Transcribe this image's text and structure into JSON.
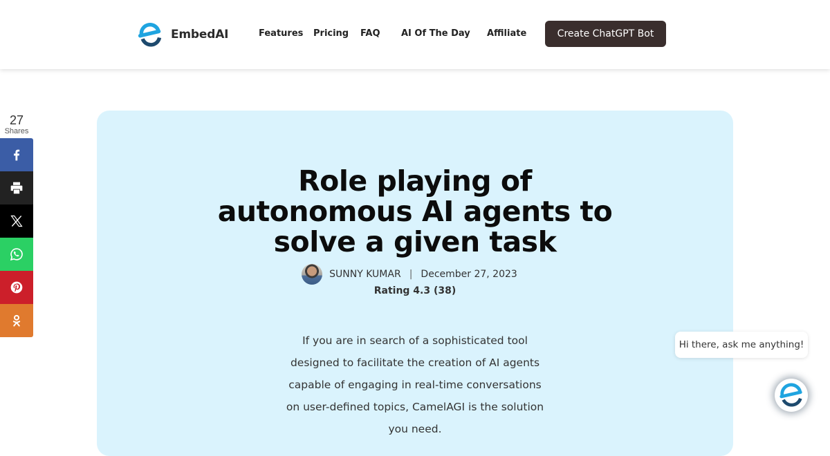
{
  "header": {
    "brand": "EmbedAI",
    "nav": [
      {
        "label": "Features"
      },
      {
        "label": "Pricing"
      },
      {
        "label": "FAQ"
      },
      {
        "label": "AI Of The Day"
      },
      {
        "label": "Affiliate"
      }
    ],
    "cta_label": "Create ChatGPT Bot"
  },
  "share": {
    "count": "27",
    "count_label": "Shares",
    "buttons": [
      {
        "network": "facebook",
        "icon": "facebook-icon",
        "color": "#3b5da6"
      },
      {
        "network": "print",
        "icon": "printer-icon",
        "color": "#222222"
      },
      {
        "network": "x",
        "icon": "x-icon",
        "color": "#000000"
      },
      {
        "network": "whatsapp",
        "icon": "whatsapp-icon",
        "color": "#2bd064"
      },
      {
        "network": "pinterest",
        "icon": "pinterest-icon",
        "color": "#cc1f2a"
      },
      {
        "network": "odnoklassniki",
        "icon": "odnoklassniki-icon",
        "color": "#e07a2e"
      }
    ]
  },
  "article": {
    "title": "Role playing of autonomous AI agents to solve a given task",
    "author": "SUNNY KUMAR",
    "separator": "|",
    "date": "December 27, 2023",
    "rating": "Rating 4.3 (38)",
    "intro": "If you are in search of a sophisticated tool designed to facilitate the creation of AI agents capable of engaging in real-time conversations on user-defined topics, CamelAGI is the solution you need."
  },
  "chat_widget": {
    "greeting": "Hi there, ask me anything!"
  },
  "colors": {
    "brand_light_blue": "#1fa4e0",
    "brand_dark_blue": "#1e4a6e",
    "cta_bg": "#3a2e2d",
    "card_bg": "#daf3fd"
  }
}
